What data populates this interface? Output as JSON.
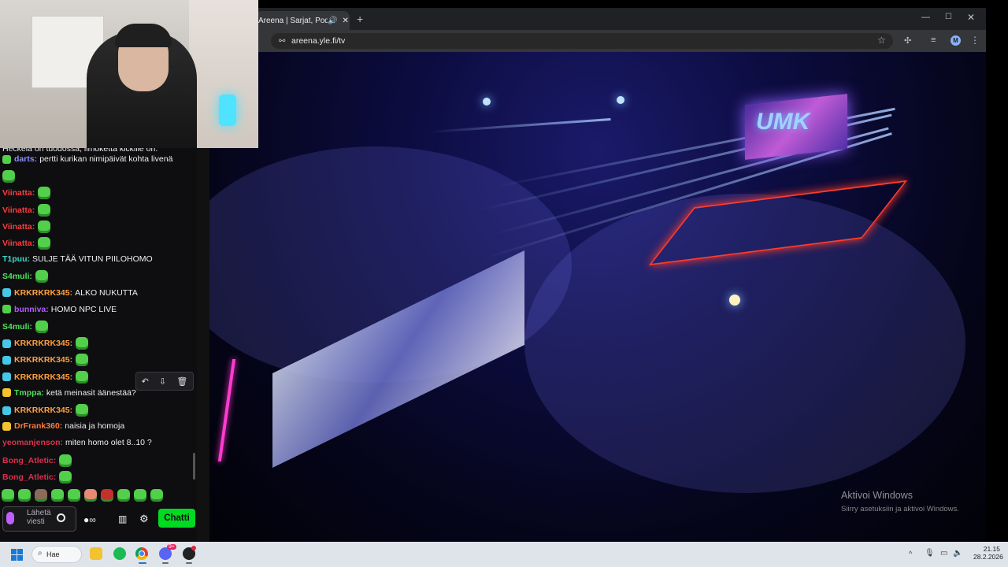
{
  "browser": {
    "tab_title": "Areena | Sarjat, Podcastit",
    "url": "areena.yle.fi/tv",
    "profile_initial": "M",
    "icons": {
      "tab_sound": "speaker-icon",
      "tab_close": "close-icon",
      "new_tab": "plus-icon",
      "star": "star-icon",
      "extensions": "puzzle-icon",
      "media": "media-control-icon",
      "menu": "kebab-menu-icon"
    }
  },
  "video": {
    "stage_logo": "UMK",
    "windows_watermark": {
      "title": "Aktivoi Windows",
      "subtitle": "Siirry asetuksiin ja aktivoi Windows."
    }
  },
  "chat": {
    "top_partial": "Heckelä on tuodossa, ilmoketta kickille on.",
    "messages": [
      {
        "user": "darts",
        "color": "#8a8fff",
        "badge": "#52d04b",
        "text": "pertti kurikan nimipäivät kohta livenä",
        "emote": false
      },
      {
        "user": "",
        "color": "#52d04b",
        "badge": "",
        "text": "",
        "emote": true
      },
      {
        "user": "Viinatta",
        "color": "#ff3b3b",
        "badge": "",
        "text": "",
        "emote": true
      },
      {
        "user": "Viinatta",
        "color": "#ff3b3b",
        "badge": "",
        "text": "",
        "emote": true
      },
      {
        "user": "Viinatta",
        "color": "#ff3b3b",
        "badge": "",
        "text": "",
        "emote": true
      },
      {
        "user": "Viinatta",
        "color": "#ff3b3b",
        "badge": "",
        "text": "",
        "emote": true
      },
      {
        "user": "T1puu",
        "color": "#3fd9c8",
        "badge": "",
        "text": "SULJE TÄÄ VITUN PIILOHOMO",
        "emote": false
      },
      {
        "user": "S4muli",
        "color": "#52e05a",
        "badge": "",
        "text": "",
        "emote": true
      },
      {
        "user": "KRKRKRK345",
        "color": "#ffa142",
        "badge": "#46c7e8",
        "text": "ALKO NUKUTTA",
        "emote": false
      },
      {
        "user": "bunniva",
        "color": "#b45cff",
        "badge": "#52d04b",
        "text": "HOMO NPC LIVE",
        "emote": false
      },
      {
        "user": "S4muli",
        "color": "#52e05a",
        "badge": "",
        "text": "",
        "emote": true
      },
      {
        "user": "KRKRKRK345",
        "color": "#ffa142",
        "badge": "#46c7e8",
        "text": "",
        "emote": true
      },
      {
        "user": "KRKRKRK345",
        "color": "#ffa142",
        "badge": "#46c7e8",
        "text": "",
        "emote": true
      },
      {
        "user": "KRKRKRK345",
        "color": "#ffa142",
        "badge": "#46c7e8",
        "text": "",
        "emote": true
      },
      {
        "user": "Tmppa",
        "color": "#52e05a",
        "badge": "#f2c230",
        "text": "ketä meinasit äänestää?",
        "emote": false
      },
      {
        "user": "KRKRKRK345",
        "color": "#ffa142",
        "badge": "#46c7e8",
        "text": "",
        "emote": true
      },
      {
        "user": "DrFrank360",
        "color": "#ff7b3b",
        "badge": "#f2c230",
        "text": "naisia ja homoja",
        "emote": false
      },
      {
        "user": "yeomanjenson",
        "color": "#d9304f",
        "badge": "",
        "text": "miten homo olet 8..10 ?",
        "emote": false
      },
      {
        "user": "Bong_Atletic",
        "color": "#d9304f",
        "badge": "",
        "text": "",
        "emote": true
      },
      {
        "user": "Bong_Atletic",
        "color": "#d9304f",
        "badge": "",
        "text": "",
        "emote": true
      }
    ],
    "tools": {
      "undo": "↶",
      "pin": "⇩",
      "delete": "🗑"
    },
    "input_placeholder": "Lähetä viesti",
    "chat_button": "Chatti",
    "icons": {
      "mic": "microphone-icon",
      "emoji": "emoji-icon",
      "points": "channel-points-icon",
      "store": "store-icon",
      "settings": "gear-icon"
    }
  },
  "taskbar": {
    "search_label": "Hae",
    "discord_badge": "9+",
    "time": "21.15",
    "date": "28.2.2026",
    "icons": [
      "windows-start-icon",
      "search-icon",
      "file-explorer-icon",
      "spotify-icon",
      "chrome-icon",
      "discord-icon",
      "obs-icon",
      "chevron-up-icon",
      "microphone-icon",
      "display-icon",
      "volume-icon"
    ]
  }
}
